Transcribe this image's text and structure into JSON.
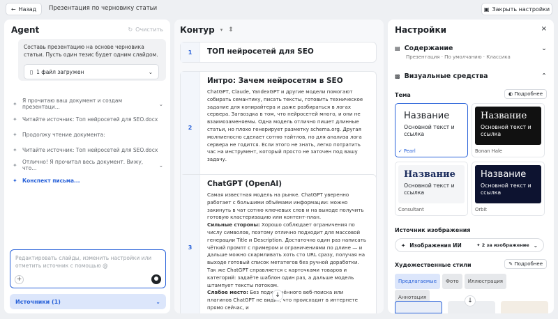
{
  "topbar": {
    "back_label": "Назад",
    "doc_title": "Презентация по черновику статьи",
    "close_settings_label": "Закрыть настройки"
  },
  "agent": {
    "title": "Agent",
    "clear_label": "Очистить",
    "user_message": "Составь презентацию на основе черновика статьи. Пусть один тезис будет одним слайдом.",
    "file_label": "1 файл загружен",
    "steps": [
      "Я прочитаю ваш документ и создам презентаци...",
      "Читайте источник: Топ нейросетей для SEO.docx",
      "Продолжу чтение документа:",
      "Читайте источник: Топ нейросетей для SEO.docx",
      "Отлично! Я прочитал весь документ. Вижу, что..."
    ],
    "konspekt": "Конспект письма...",
    "input_placeholder": "Редактировать слайды, изменить настройки или отметить источник с помощью @",
    "sources_label": "Источники (1)"
  },
  "outline": {
    "title": "Контур",
    "slides": [
      {
        "num": "1",
        "title": "ТОП нейросетей для SEO",
        "text": ""
      },
      {
        "num": "2",
        "title": "Интро: Зачем нейросетям в SEO",
        "text": "ChatGPT, Claude, YandexGPT и другие модели помогают собирать семантику, писать тексты, готовить техническое задание для копирайтера и даже разбираться в логах сервера. Загвоздка в том, что нейросетей много, и они не взаимозаменяемы. Одна модель отлично пишет длинные статьи, но плохо генерирует разметку schema.org. Другая молниеносно сделает сотню тайтлов, но для анализа лога сервера не годится. Если этого не знать, легко потратить час на инструмент, который просто не заточен под вашу задачу."
      },
      {
        "num": "3",
        "title": "ChatGPT (OpenAI)",
        "text": "Самая известная модель на рынке. ChatGPT уверенно работает с большими объёмами информации: можно закинуть в чат сотню ключевых слов и на выходе получить готовую кластеризацию или контент-план.",
        "strong": "Сильные стороны:",
        "text2": " Хорошо соблюдает ограничения по числу символов, поэтому отлично подходит для массовой генерации Title и Description. Достаточно один раз написать чёткий промпт с примером и ограничениями по длине — и дальше можно скармливать хоть сто URL сразу, получая на выходе готовый список метатегов без ручной доработки. Так же ChatGPT справляется с карточками товаров и категорий: задаёте шаблон один раз, а дальше модель штампует тексты потоком.",
        "strong2": "Слабое место:",
        "text3": " Без подключённого веб-поиска или плагинов ChatGPT не видит, что происходит в интернете прямо сейчас, и"
      }
    ]
  },
  "settings": {
    "title": "Настройки",
    "content_label": "Содержание",
    "content_sub": "Презентация · По умолчанию · Классика",
    "visual_label": "Визуальные средства",
    "theme_label": "Тема",
    "more_label": "Подробнее",
    "themes": [
      {
        "name": "Pearl",
        "title": "Название",
        "text": "Основной текст и ссылка",
        "selected": "✓ Pearl"
      },
      {
        "name": "Bonan Hale",
        "title": "Название",
        "text": "Основной текст и ссылка"
      },
      {
        "name": "Consultant",
        "title": "Название",
        "text": "Основной текст и ссылка"
      },
      {
        "name": "Orbit",
        "title": "Название",
        "text": "Основной текст и ссылка"
      }
    ],
    "image_source_label": "Источник изображения",
    "image_source_value": "Изображения ИИ",
    "image_count": "2 за изображение",
    "art_styles_label": "Художественные стили",
    "art_more_label": "Подробнее",
    "art_styles": [
      "Предлагаемые",
      "Фото",
      "Иллюстрация",
      "Аннотация"
    ]
  }
}
